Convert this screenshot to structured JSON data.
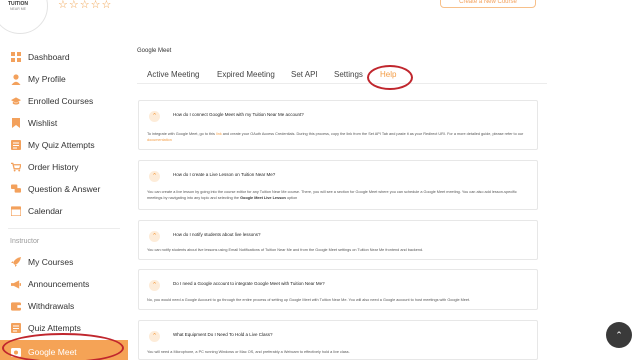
{
  "header": {
    "logo_text": "TUITION",
    "logo_sub": "NEAR ME",
    "rating_stars": "☆☆☆☆☆",
    "top_button_label": "Create a New Course"
  },
  "sidebar": {
    "items": [
      {
        "label": "Dashboard",
        "icon": "dashboard-icon"
      },
      {
        "label": "My Profile",
        "icon": "user-icon"
      },
      {
        "label": "Enrolled Courses",
        "icon": "graduation-icon"
      },
      {
        "label": "Wishlist",
        "icon": "bookmark-icon"
      },
      {
        "label": "My Quiz Attempts",
        "icon": "quiz-icon"
      },
      {
        "label": "Order History",
        "icon": "cart-icon"
      },
      {
        "label": "Question & Answer",
        "icon": "qa-icon"
      },
      {
        "label": "Calendar",
        "icon": "calendar-icon"
      }
    ],
    "section_label": "Instructor",
    "instructor_items": [
      {
        "label": "My Courses",
        "icon": "rocket-icon"
      },
      {
        "label": "Announcements",
        "icon": "megaphone-icon"
      },
      {
        "label": "Withdrawals",
        "icon": "wallet-icon"
      },
      {
        "label": "Quiz Attempts",
        "icon": "quiz-icon"
      },
      {
        "label": "Google Meet",
        "icon": "video-icon",
        "active": true
      }
    ]
  },
  "main": {
    "page_title": "Google Meet",
    "tabs": [
      {
        "label": "Active Meeting"
      },
      {
        "label": "Expired Meeting"
      },
      {
        "label": "Set API"
      },
      {
        "label": "Settings"
      },
      {
        "label": "Help",
        "active": true
      }
    ],
    "faqs": [
      {
        "question": "How do I connect Google Meet with my Tuition Near Me account?",
        "answer_pre": "To integrate with Google Meet, go to this",
        "answer_link": "link",
        "answer_mid": "and create your OAuth Access Credentials. During this process, copy the link from the Set API Tab and paste it as your Redirect URI. For a more detailed guide, please refer to our",
        "answer_link2": "documentation"
      },
      {
        "question": "How do I create a Live Lesson on Tuition Near Me?",
        "answer_pre": "You can create a live lesson by going into the course editor for any Tuition Near Me course. There, you will see a section for Google Meet where you can schedule a Google Meet meeting. You can also add lesson-specific meetings by navigating into any topic and selecting the",
        "answer_bold": "Google Meet Live Lesson",
        "answer_post": "option"
      },
      {
        "question": "How do I notify students about live lessons?",
        "answer_pre": "You can notify students about live lessons using Email Notifications of Tuition Near Me and from the Google Meet settings on Tuition Near Me frontend and backend."
      },
      {
        "question": "Do I need a Google account to integrate Google Meet with Tuition Near Me?",
        "answer_pre": "No, you would need a Google Account to go through the entire process of setting up Google Meet with Tuition Near Me. You will also need a Google account to host meetings with Google Meet."
      },
      {
        "question": "What Equipment Do I Need To Hold a Live Class?",
        "answer_pre": "You will need a Microphone, a PC running Windows or Mac OS, and preferably a Webcam to effectively hold a live class."
      }
    ]
  },
  "colors": {
    "accent": "#f39c44",
    "annotation_ring": "#c0262d",
    "active_nav_bg": "#f5a356"
  },
  "scroll_top": {
    "label": "⌃"
  }
}
